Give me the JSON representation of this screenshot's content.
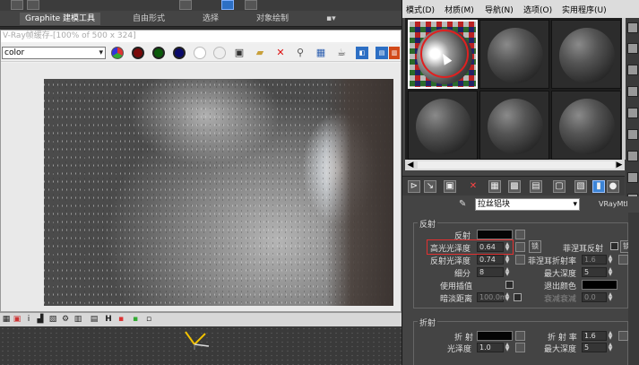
{
  "ribbon": {
    "tabs": [
      "Graphite 建模工具",
      "自由形式",
      "选择",
      "对象绘制"
    ]
  },
  "vfb": {
    "title": "V-Ray帧缓存-[100% of 500 x 324]",
    "channel": "color"
  },
  "material_editor": {
    "menu": [
      "模式(D)",
      "材质(M)",
      "导航(N)",
      "选项(O)",
      "实用程序(U)"
    ],
    "material_name": "拉丝铝块",
    "material_type": "VRayMtl",
    "reflection": {
      "header": "反射",
      "reflect_label": "反射",
      "hilight_gloss_label": "高光光泽度",
      "hilight_gloss_value": "0.64",
      "refl_gloss_label": "反射光泽度",
      "refl_gloss_value": "0.74",
      "subdivs_label": "细分",
      "subdivs_value": "8",
      "use_interp_label": "使用插值",
      "dim_distance_label": "暗淡距离",
      "dim_distance_value": "100.0m",
      "fresnel_label": "菲涅耳反射",
      "fresnel_ior_label": "菲涅耳折射率",
      "fresnel_ior_value": "1.6",
      "max_depth_label": "最大深度",
      "max_depth_value": "5",
      "exit_color_label": "退出颜色",
      "dim_falloff_label": "衰减衰减",
      "dim_falloff_value": "0.0",
      "lock_label": "锁"
    },
    "refraction": {
      "header": "折射",
      "refract_label": "折 射",
      "ior_label": "折 射 率",
      "ior_value": "1.6",
      "gloss_label": "光泽度",
      "gloss_value": "1.0",
      "max_depth_label": "最大深度",
      "max_depth_value": "5"
    }
  },
  "colors": {
    "highlight_box": "#e23030",
    "active_tool": "#3c84d6"
  }
}
